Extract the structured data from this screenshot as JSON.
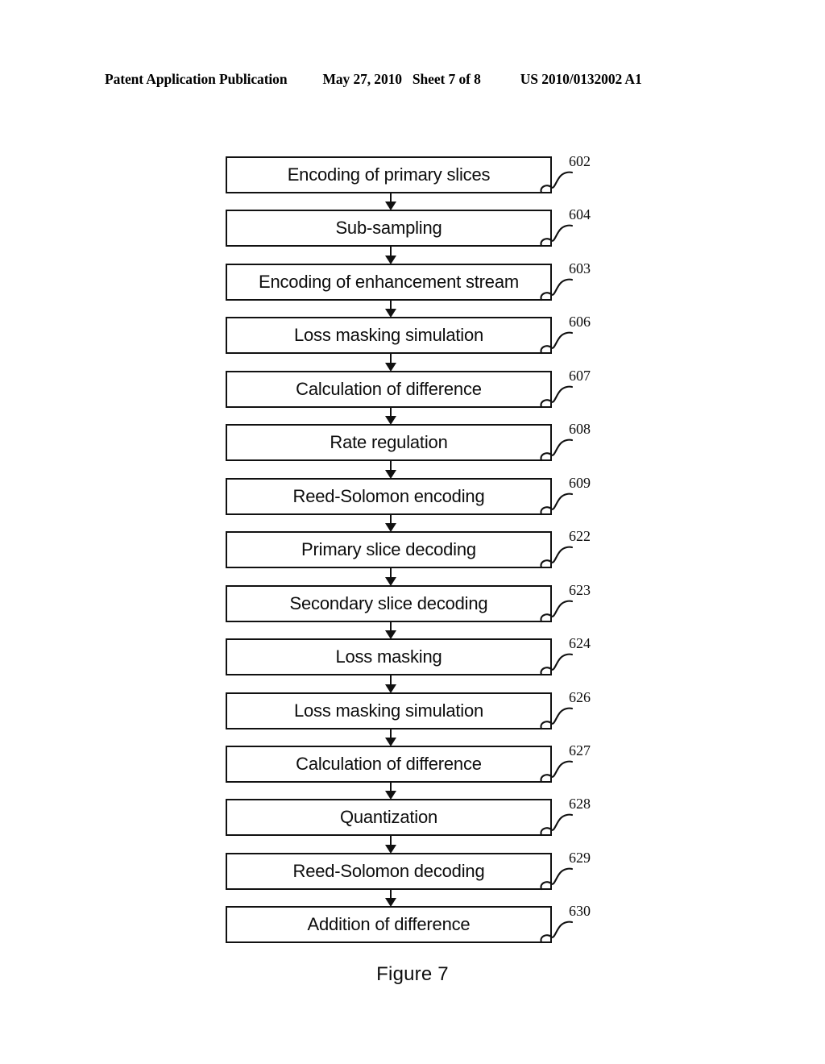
{
  "header": {
    "publication": "Patent Application Publication",
    "date": "May 27, 2010",
    "sheet": "Sheet 7 of 8",
    "document_number": "US 2010/0132002 A1"
  },
  "figure": {
    "caption": "Figure 7",
    "type": "flowchart",
    "orientation": "vertical",
    "connector": "downward-arrow",
    "line_color": "#111111",
    "background_color": "#ffffff",
    "steps": [
      {
        "ref": "602",
        "label": "Encoding of primary slices"
      },
      {
        "ref": "604",
        "label": "Sub-sampling"
      },
      {
        "ref": "603",
        "label": "Encoding of enhancement stream"
      },
      {
        "ref": "606",
        "label": "Loss masking simulation"
      },
      {
        "ref": "607",
        "label": "Calculation of difference"
      },
      {
        "ref": "608",
        "label": "Rate regulation"
      },
      {
        "ref": "609",
        "label": "Reed-Solomon encoding"
      },
      {
        "ref": "622",
        "label": "Primary slice decoding"
      },
      {
        "ref": "623",
        "label": "Secondary slice decoding"
      },
      {
        "ref": "624",
        "label": "Loss masking"
      },
      {
        "ref": "626",
        "label": "Loss masking simulation"
      },
      {
        "ref": "627",
        "label": "Calculation of difference"
      },
      {
        "ref": "628",
        "label": "Quantization"
      },
      {
        "ref": "629",
        "label": "Reed-Solomon decoding"
      },
      {
        "ref": "630",
        "label": "Addition of difference"
      }
    ]
  }
}
